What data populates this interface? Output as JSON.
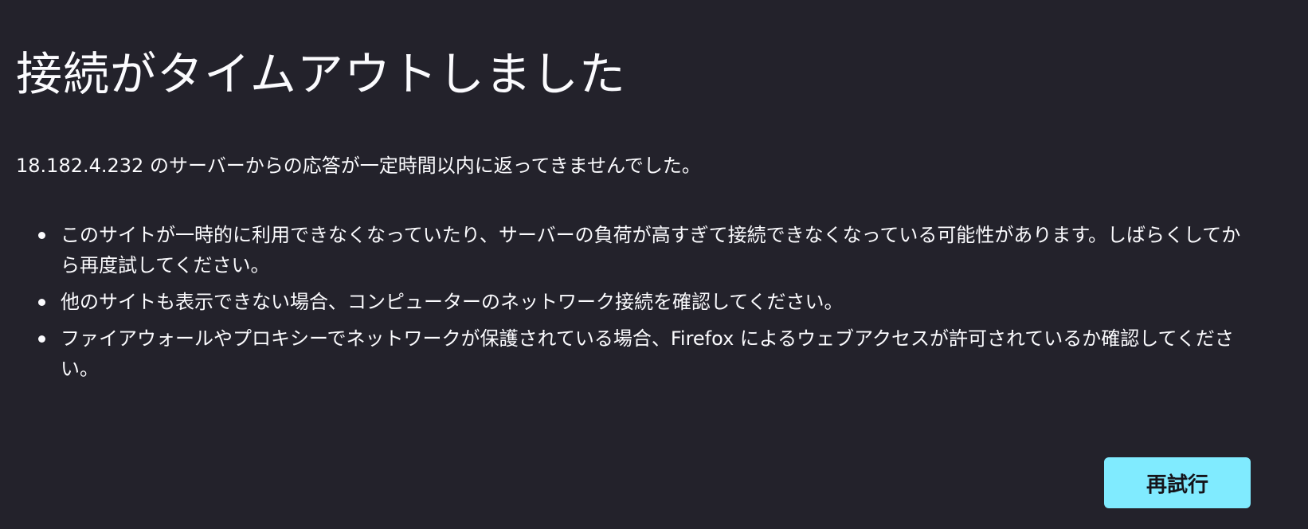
{
  "error": {
    "title": "接続がタイムアウトしました",
    "description": "18.182.4.232 のサーバーからの応答が一定時間以内に返ってきませんでした。",
    "tips": [
      "このサイトが一時的に利用できなくなっていたり、サーバーの負荷が高すぎて接続できなくなっている可能性があります。しばらくしてから再度試してください。",
      "他のサイトも表示できない場合、コンピューターのネットワーク接続を確認してください。",
      "ファイアウォールやプロキシーでネットワークが保護されている場合、Firefox によるウェブアクセスが許可されているか確認してください。"
    ],
    "retry_label": "再試行"
  },
  "colors": {
    "background": "#23222b",
    "text": "#fbfbfe",
    "button": "#80ebff",
    "button_text": "#15141a"
  }
}
